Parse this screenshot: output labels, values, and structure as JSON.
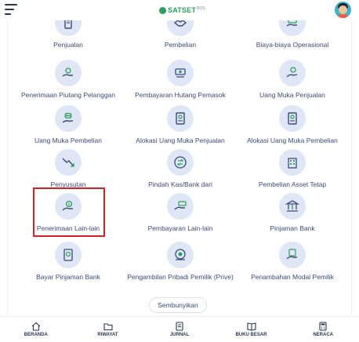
{
  "header": {
    "logo_text": "SATSET",
    "logo_sup": "BOS"
  },
  "menu": [
    {
      "label": "Penjualan",
      "icon": "receipt-icon"
    },
    {
      "label": "Pembelian",
      "icon": "handshake-icon"
    },
    {
      "label": "Biaya-biaya Operasional",
      "icon": "money-hand-icon"
    },
    {
      "label": "Penerimaan Piutang Pelanggan",
      "icon": "cash-receive-icon"
    },
    {
      "label": "Pembayaran Hutang Pemasok",
      "icon": "cash-pay-icon"
    },
    {
      "label": "Uang Muka Penjualan",
      "icon": "coin-hand-icon"
    },
    {
      "label": "Uang Muka Pembelian",
      "icon": "coin-stack-hand-icon"
    },
    {
      "label": "Alokasi Uang Muka Penjualan",
      "icon": "document-alloc-icon"
    },
    {
      "label": "Alokasi Uang Muka Pembelian",
      "icon": "document-alloc-icon"
    },
    {
      "label": "Penyusutan",
      "icon": "depreciation-icon"
    },
    {
      "label": "Pindah Kas/Bank dari",
      "icon": "transfer-icon"
    },
    {
      "label": "Pembelian Asset Tetap",
      "icon": "building-icon"
    },
    {
      "label": "Penerimaan Lain-lain",
      "icon": "dollar-hand-icon"
    },
    {
      "label": "Pembayaran Lain-lain",
      "icon": "cash-give-icon"
    },
    {
      "label": "Pinjaman Bank",
      "icon": "bank-icon"
    },
    {
      "label": "Bayar Pinjaman Bank",
      "icon": "bank-doc-icon"
    },
    {
      "label": "Pengambilan Pribadi Pemilik (Prive)",
      "icon": "owner-withdraw-icon"
    },
    {
      "label": "Penambahan Modal Pemilik",
      "icon": "capital-add-icon"
    }
  ],
  "hide_button": "Sembunyikan",
  "nav": [
    {
      "label": "BERANDA",
      "icon": "home-icon"
    },
    {
      "label": "RIWAYAT",
      "icon": "folder-icon"
    },
    {
      "label": "JURNAL",
      "icon": "journal-icon"
    },
    {
      "label": "BUKU BESAR",
      "icon": "book-icon"
    },
    {
      "label": "NERACA",
      "icon": "calculator-icon"
    }
  ],
  "colors": {
    "accent": "#2e9f5a",
    "icon_bg": "#dfe7f6",
    "text": "#3c4a7a",
    "highlight": "#d91f26"
  }
}
